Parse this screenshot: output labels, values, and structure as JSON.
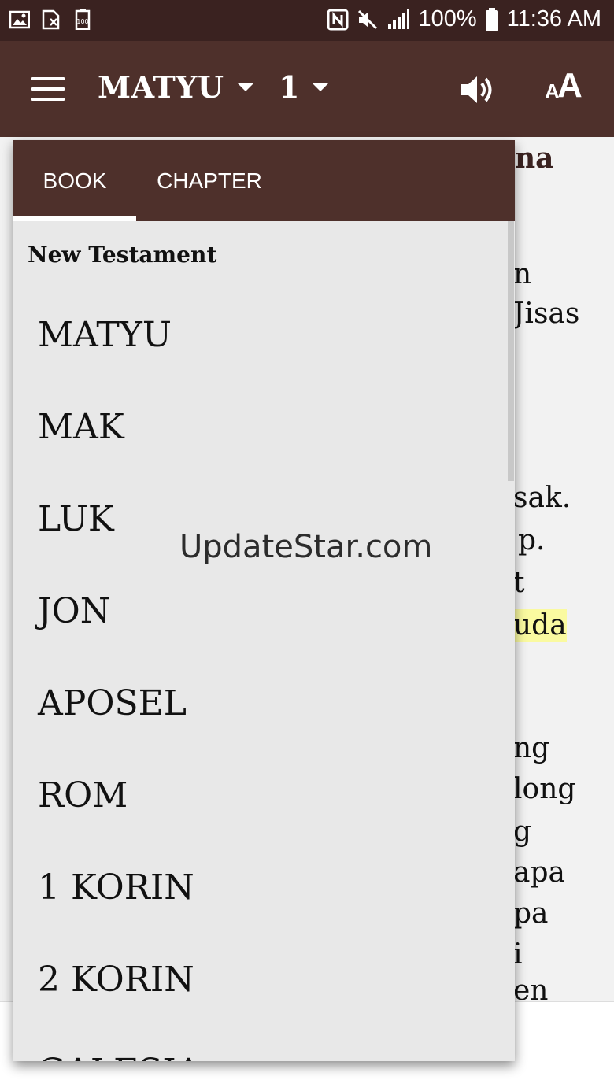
{
  "status_bar": {
    "icons_left": [
      "image-icon",
      "sim-error-icon",
      "battery-100-icon"
    ],
    "icons_right": [
      "nfc-icon",
      "mute-icon",
      "signal-icon",
      "battery-icon"
    ],
    "battery": "100%",
    "time": "11:36 AM"
  },
  "toolbar": {
    "book": "MATYU",
    "chapter": "1",
    "font_small": "A",
    "font_big": "A"
  },
  "tabs": {
    "book": "BOOK",
    "chapter": "CHAPTER"
  },
  "section_title": "New Testament",
  "books": [
    "MATYU",
    "MAK",
    "LUK",
    "JON",
    "APOSEL",
    "ROM",
    "1 KORIN",
    "2 KORIN",
    "GALESIA"
  ],
  "reading_fragments": [
    "na",
    "n",
    "Jisas",
    "sak.",
    "p.",
    "t",
    "uda",
    "ng",
    "long",
    "g",
    "apa",
    "pa",
    "i",
    "en"
  ],
  "watermark": "UpdateStar.com",
  "colors": {
    "toolbar": "#4e302b",
    "status_bar": "#3a2220",
    "panel": "#e8e8e8",
    "highlight": "#fafaa0"
  }
}
